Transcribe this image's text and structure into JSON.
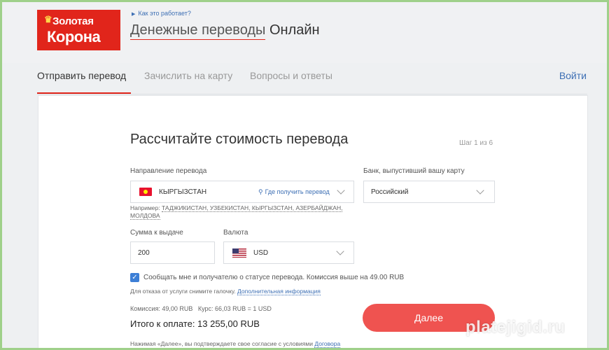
{
  "header": {
    "logo_line1": "Золотая",
    "logo_line2": "Корона",
    "how_link": "Как это работает?",
    "title_part1": "Денежные переводы",
    "title_part2": "Онлайн"
  },
  "tabs": [
    {
      "label": "Отправить перевод",
      "active": true
    },
    {
      "label": "Зачислить на карту",
      "active": false
    },
    {
      "label": "Вопросы и ответы",
      "active": false
    }
  ],
  "login_label": "Войти",
  "form": {
    "title": "Рассчитайте стоимость перевода",
    "step": "Шаг 1 из 6",
    "direction_label": "Направление перевода",
    "direction_value": "КЫРГЫЗСТАН",
    "where_link": "Где получить перевод",
    "bank_label": "Банк, выпустивший вашу карту",
    "bank_value": "Российский",
    "example_prefix": "Например:",
    "example_countries": "ТАДЖИКИСТАН, УЗБЕКИСТАН, КЫРГЫЗСТАН, АЗЕРБАЙДЖАН,",
    "example_countries2": "МОЛДОВА",
    "amount_label": "Сумма к выдаче",
    "amount_value": "200",
    "currency_label": "Валюта",
    "currency_value": "USD",
    "notify_text": "Сообщать мне и получателю о статусе перевода. Комиссия выше на 49.00 RUB",
    "notify_checked": true,
    "optout_text": "Для отказа от услуги снимите галочку.",
    "optout_link": "Дополнительная информация",
    "commission": "Комиссия: 49,00 RUB",
    "rate": "Курс: 66,03 RUB = 1 USD",
    "total": "Итого к оплате: 13 255,00 RUB",
    "next_button": "Далее",
    "terms_text": "Нажимая «Далее», вы подтверждаете свое согласие с условиями",
    "terms_link": "Договора"
  },
  "watermark": "platejigid.ru",
  "colors": {
    "brand_red": "#e1251b",
    "link_blue": "#3d6fb4",
    "button_red": "#ef5350"
  }
}
